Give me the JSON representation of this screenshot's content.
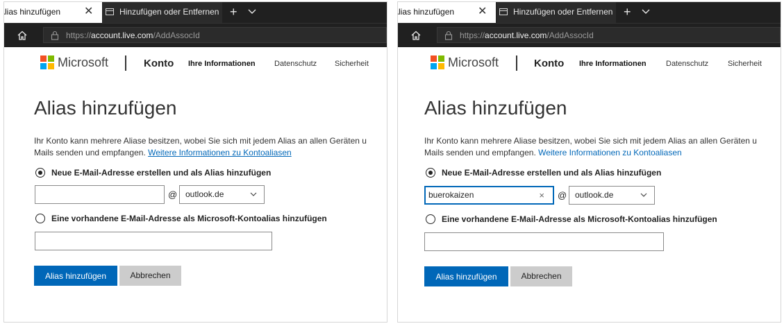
{
  "browser": {
    "active_tab_title": "Alias hinzufügen",
    "inactive_tab_title": "Hinzufügen oder Entfernen",
    "tab_close_glyph": "✕",
    "new_tab_glyph": "+",
    "url_prefix": "https://",
    "url_host": "account.live.com",
    "url_path": "/AddAssocId"
  },
  "header": {
    "brand": "Microsoft",
    "section": "Konto",
    "nav": [
      "Ihre Informationen",
      "Datenschutz",
      "Sicherheit"
    ]
  },
  "page": {
    "title": "Alias hinzufügen",
    "desc_line1": "Ihr Konto kann mehrere Aliase besitzen, wobei Sie sich mit jedem Alias an allen Geräten u",
    "desc_line2": "Mails senden und empfangen. ",
    "more_info_link": "Weitere Informationen zu Kontoaliasen",
    "option_new_label": "Neue E-Mail-Adresse erstellen und als Alias hinzufügen",
    "option_existing_label": "Eine vorhandene E-Mail-Adresse als Microsoft-Kontoalias hinzufügen",
    "at_sign": "@",
    "domain_selected": "outlook.de",
    "submit_label": "Alias hinzufügen",
    "cancel_label": "Abbrechen"
  },
  "left": {
    "alias_input_value": ""
  },
  "right": {
    "alias_input_value": "buerokaizen",
    "clear_glyph": "×"
  },
  "colors": {
    "accent": "#0067b8",
    "chrome": "#202020"
  }
}
